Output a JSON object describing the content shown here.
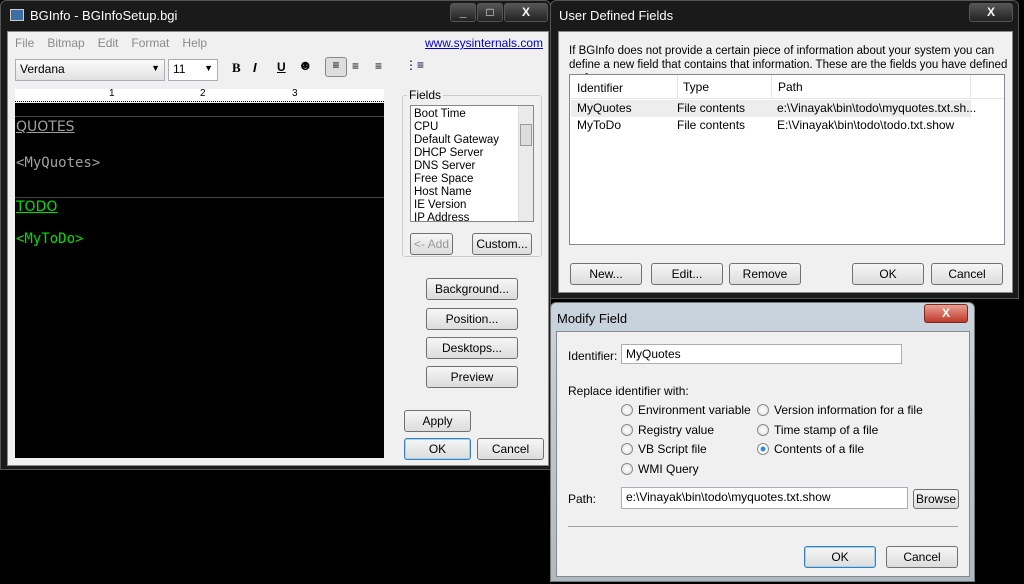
{
  "main": {
    "title": "BGInfo - BGInfoSetup.bgi",
    "menu": [
      "File",
      "Bitmap",
      "Edit",
      "Format",
      "Help"
    ],
    "link": "www.sysinternals.com",
    "font": "Verdana",
    "size": "11",
    "ruler": [
      "1",
      "2",
      "3"
    ],
    "editor": {
      "h1": "QUOTES",
      "v1": "<MyQuotes>",
      "h2": "TODO",
      "v2": "<MyToDo>",
      "color1": "#a0a0a0",
      "color2": "#00e000"
    },
    "fields_label": "Fields",
    "fields": [
      "Boot Time",
      "CPU",
      "Default Gateway",
      "DHCP Server",
      "DNS Server",
      "Free Space",
      "Host Name",
      "IE Version",
      "IP Address"
    ],
    "add": "<- Add",
    "custom": "Custom...",
    "background": "Background...",
    "position": "Position...",
    "desktops": "Desktops...",
    "preview": "Preview",
    "apply": "Apply",
    "ok": "OK",
    "cancel": "Cancel"
  },
  "udf": {
    "title": "User Defined Fields",
    "desc": "If BGInfo does not provide a certain piece of information about your system you can define a new field that contains that information. These are the fields you have defined so far:",
    "columns": [
      "Identifier",
      "Type",
      "Path"
    ],
    "rows": [
      {
        "id": "MyQuotes",
        "type": "File contents",
        "path": "e:\\Vinayak\\bin\\todo\\myquotes.txt.sh..."
      },
      {
        "id": "MyToDo",
        "type": "File contents",
        "path": "E:\\Vinayak\\bin\\todo\\todo.txt.show"
      }
    ],
    "new": "New...",
    "edit": "Edit...",
    "remove": "Remove",
    "ok": "OK",
    "cancel": "Cancel"
  },
  "modify": {
    "title": "Modify Field",
    "identifier_label": "Identifier:",
    "identifier": "MyQuotes",
    "replace_label": "Replace identifier with:",
    "options": [
      "Environment variable",
      "Registry value",
      "VB Script file",
      "WMI Query",
      "Version information for a file",
      "Time stamp of a file",
      "Contents of a file"
    ],
    "selected": "Contents of a file",
    "path_label": "Path:",
    "path": "e:\\Vinayak\\bin\\todo\\myquotes.txt.show",
    "browse": "Browse",
    "ok": "OK",
    "cancel": "Cancel"
  }
}
